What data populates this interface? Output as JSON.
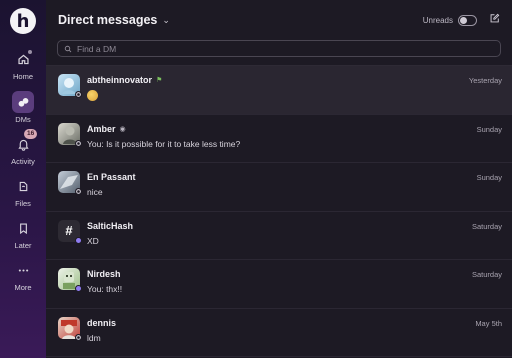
{
  "rail": {
    "logo_letter": "h",
    "items": [
      {
        "label": "Home",
        "icon": "home-icon"
      },
      {
        "label": "DMs",
        "icon": "dms-icon"
      },
      {
        "label": "Activity",
        "icon": "bell-icon",
        "badge": "16"
      },
      {
        "label": "Files",
        "icon": "files-icon"
      },
      {
        "label": "Later",
        "icon": "bookmark-icon"
      },
      {
        "label": "More",
        "icon": "more-icon"
      }
    ]
  },
  "header": {
    "title": "Direct messages",
    "unreads_label": "Unreads"
  },
  "search": {
    "placeholder": "Find a DM"
  },
  "conversations": [
    {
      "name": "abtheinnovator",
      "preview": "",
      "date": "Yesterday",
      "presence": "away",
      "avatar_color": "#6fa7c8"
    },
    {
      "name": "Amber",
      "preview": "You: Is it possible for it to take less time?",
      "date": "Sunday",
      "presence": "away",
      "avatar_color": "#8a8f86"
    },
    {
      "name": "En Passant",
      "preview": "nice",
      "date": "Sunday",
      "presence": "away",
      "avatar_color": "#7f8a99"
    },
    {
      "name": "SalticHash",
      "preview": "XD",
      "date": "Saturday",
      "presence": "active",
      "avatar_glyph": "#",
      "avatar_color": "#2d2a33"
    },
    {
      "name": "Nirdesh",
      "preview": "You: thx!!",
      "date": "Saturday",
      "presence": "active",
      "avatar_color": "#9dbf88"
    },
    {
      "name": "dennis",
      "preview": "ldm",
      "date": "May 5th",
      "presence": "away",
      "avatar_color": "#c0413a"
    }
  ],
  "colors": {
    "rail_top": "#1b1330",
    "rail_bottom": "#3a1a58",
    "main_bg": "#1d1a24",
    "selected_row": "#2a2631",
    "active_presence": "#8f7cf0",
    "badge_bg": "#d7a8b6"
  }
}
